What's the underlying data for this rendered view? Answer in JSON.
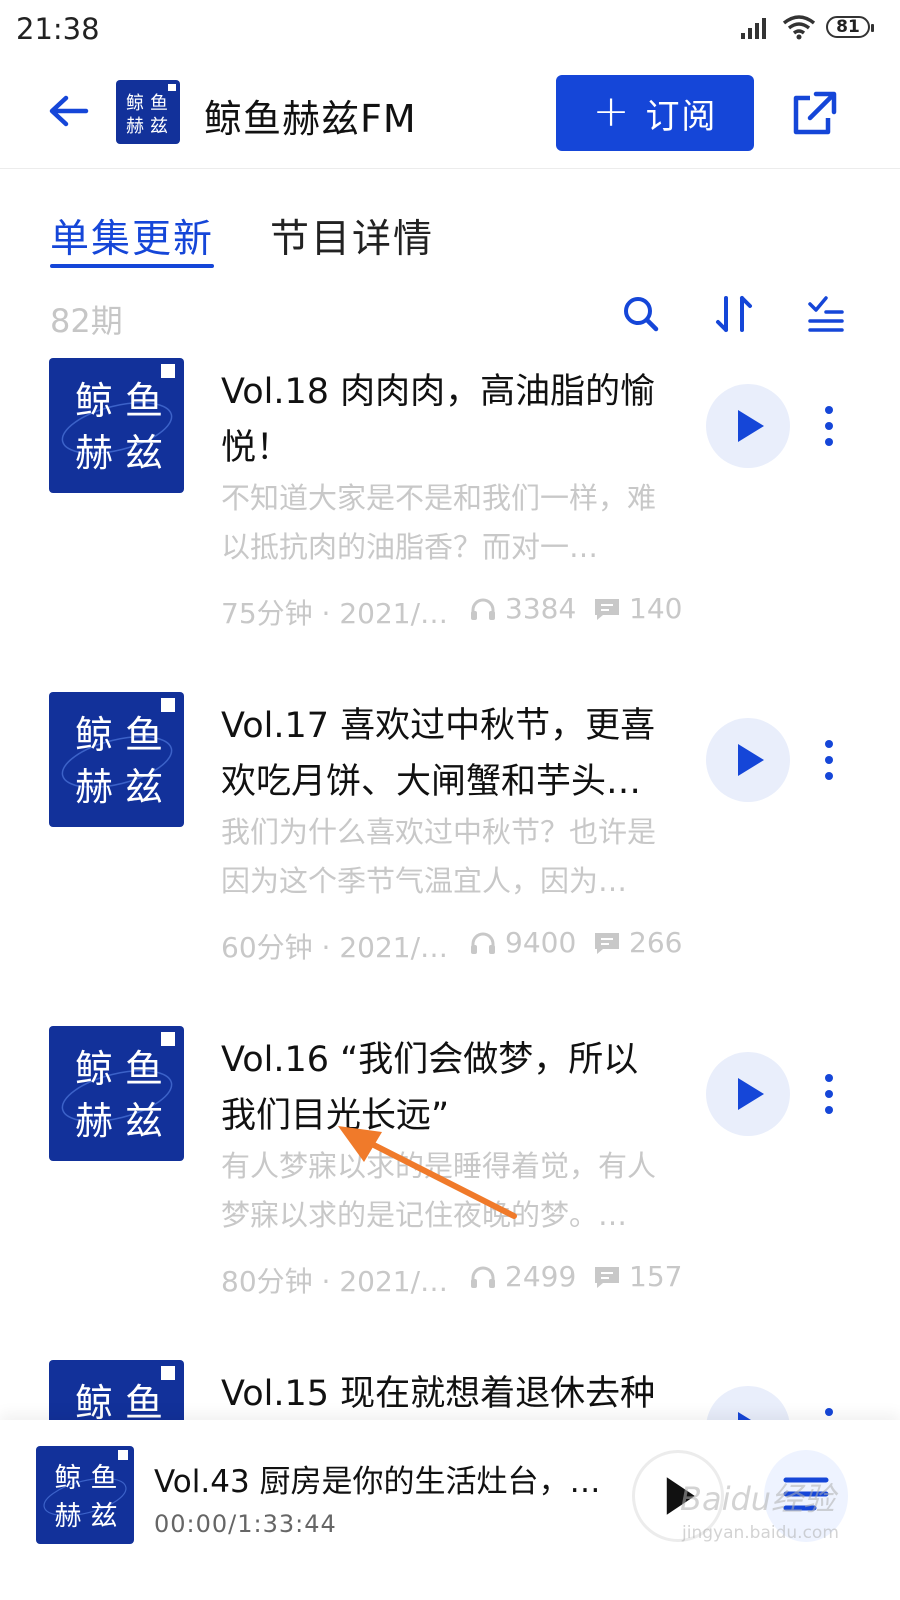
{
  "status_bar": {
    "time": "21:38",
    "battery": "81"
  },
  "header": {
    "title": "鲸鱼赫兹FM",
    "subscribe_label": "订阅",
    "cover_text": [
      "鲸",
      "鱼",
      "赫",
      "兹"
    ]
  },
  "tabs": [
    {
      "label": "单集更新",
      "active": true
    },
    {
      "label": "节目详情",
      "active": false
    }
  ],
  "list": {
    "count": "82期",
    "episodes": [
      {
        "title": "Vol.18 肉肉肉，高油脂的愉悦！",
        "desc": "不知道大家是不是和我们一样，难以抵抗肉的油脂香？而对一…",
        "duration_date": "75分钟 · 2021/…",
        "plays": "3384",
        "comments": "140"
      },
      {
        "title": "Vol.17 喜欢过中秋节，更喜欢吃月饼、大闸蟹和芋头…",
        "desc": "我们为什么喜欢过中秋节？也许是因为这个季节气温宜人，因为…",
        "duration_date": "60分钟 · 2021/…",
        "plays": "9400",
        "comments": "266"
      },
      {
        "title": "Vol.16 “我们会做梦，所以我们目光长远”",
        "desc": "有人梦寐以求的是睡得着觉，有人梦寐以求的是记住夜晚的梦。…",
        "duration_date": "80分钟 · 2021/…",
        "plays": "2499",
        "comments": "157"
      },
      {
        "title": "Vol.15 现在就想着退休去种",
        "desc": "",
        "duration_date": "",
        "plays": "",
        "comments": ""
      }
    ]
  },
  "player": {
    "title": "Vol.43 厨房是你的生活灶台，…",
    "time": "00:00/1:33:44"
  },
  "watermark": {
    "brand": "Baidu经验",
    "url": "jingyan.baidu.com"
  },
  "colors": {
    "accent": "#1546d8",
    "cover_bg": "#12319a",
    "annotation_arrow": "#f07a2a"
  }
}
